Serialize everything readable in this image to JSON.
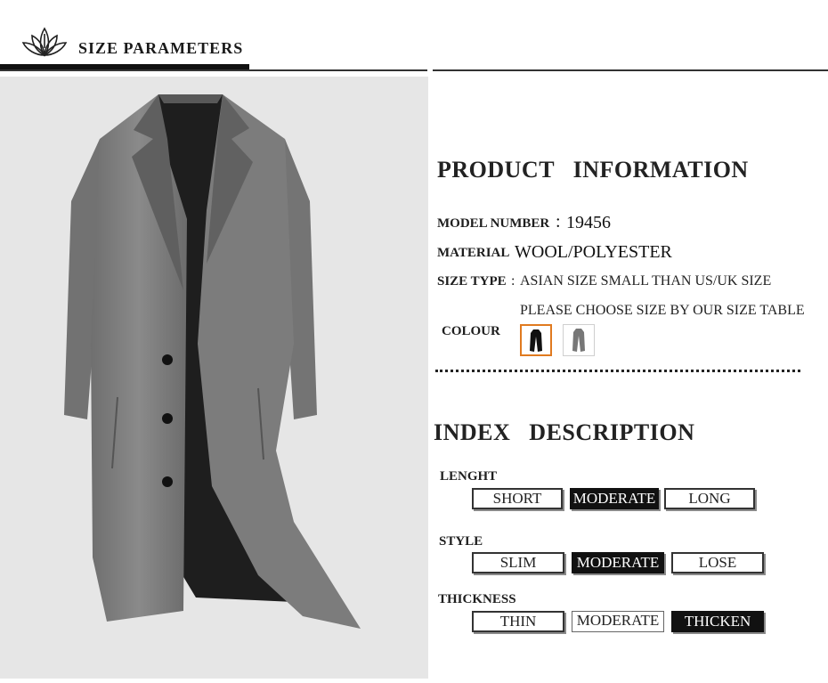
{
  "header": {
    "title": "SIZE PARAMETERS",
    "logo_icon": "lotus-icon"
  },
  "product": {
    "heading": "PRODUCT   INFORMATION",
    "model_label": "MODEL NUMBER",
    "model_sep": ":",
    "model_value": "19456",
    "material_label": "MATERIAL",
    "material_value": "WOOL/POLYESTER",
    "size_type_label": "SIZE TYPE",
    "size_type_sep": ":",
    "size_type_value": "ASIAN SIZE SMALL THAN US/UK SIZE",
    "size_note": "PLEASE CHOOSE SIZE BY OUR SIZE TABLE",
    "colour_label": "COLOUR",
    "colours": [
      "black-coat-swatch",
      "grey-coat-swatch"
    ],
    "selected_colour_border": "#e07a1f"
  },
  "index": {
    "heading": "INDEX   DESCRIPTION",
    "groups": [
      {
        "label": "LENGHT",
        "options": [
          "SHORT",
          "MODERATE",
          "LONG"
        ],
        "selected": 1
      },
      {
        "label": "STYLE",
        "options": [
          "SLIM",
          "MODERATE",
          "LOSE"
        ],
        "selected": 1
      },
      {
        "label": "THICKNESS",
        "options": [
          "THIN",
          "MODERATE",
          "THICKEN"
        ],
        "selected": 2
      }
    ]
  },
  "colors": {
    "coat_grey": "#7a7a7a",
    "coat_lining": "#1e1e1e",
    "panel_bg": "#e6e6e6"
  }
}
